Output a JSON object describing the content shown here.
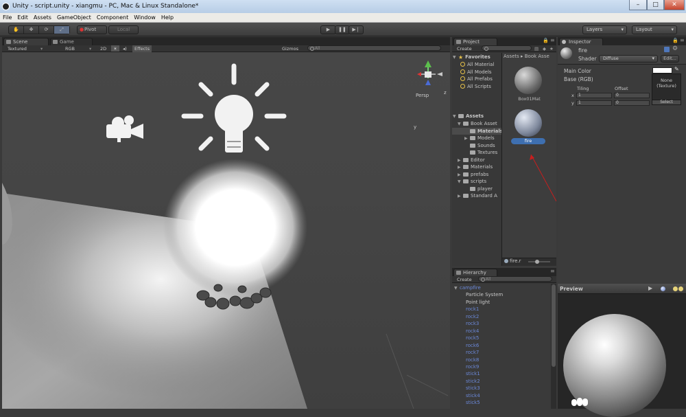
{
  "window": {
    "title": "Unity - script.unity - xiangmu - PC, Mac & Linux Standalone*"
  },
  "menu": [
    "File",
    "Edit",
    "Assets",
    "GameObject",
    "Component",
    "Window",
    "Help"
  ],
  "toolbar": {
    "pivot": "Pivot",
    "local": "Local",
    "layers": "Layers",
    "layout": "Layout"
  },
  "scene": {
    "tab_scene": "Scene",
    "tab_game": "Game",
    "shading": "Textured",
    "render_mode": "RGB",
    "mode_2d": "2D",
    "effects": "Effects",
    "gizmos": "Gizmos",
    "search_placeholder": "All",
    "persp": "Persp"
  },
  "project": {
    "tab": "Project",
    "create": "Create",
    "search_placeholder": "",
    "favorites": {
      "label": "Favorites",
      "items": [
        "All Material",
        "All Models",
        "All Prefabs",
        "All Scripts"
      ]
    },
    "assets": {
      "label": "Assets",
      "items": [
        {
          "label": "Book Asset",
          "level": 1
        },
        {
          "label": "Materials",
          "level": 2
        },
        {
          "label": "Models",
          "level": 2
        },
        {
          "label": "Sounds",
          "level": 2
        },
        {
          "label": "Textures",
          "level": 2
        },
        {
          "label": "Editor",
          "level": 1
        },
        {
          "label": "Materials",
          "level": 1
        },
        {
          "label": "prefabs",
          "level": 1
        },
        {
          "label": "scripts",
          "level": 1
        },
        {
          "label": "player",
          "level": 2
        },
        {
          "label": "Standard A",
          "level": 1
        }
      ]
    },
    "breadcrumb": "Assets ▸ Book Asse",
    "grid_items": [
      "Box01Mat",
      "fire"
    ],
    "footer": "fire.r"
  },
  "hierarchy": {
    "tab": "Hierarchy",
    "create": "Create",
    "search_placeholder": "All",
    "items": [
      {
        "label": "campfire",
        "level": 0,
        "color": "blue"
      },
      {
        "label": "Particle System",
        "level": 1,
        "color": "white"
      },
      {
        "label": "Point light",
        "level": 1,
        "color": "white"
      },
      {
        "label": "rock1",
        "level": 1,
        "color": "blue"
      },
      {
        "label": "rock2",
        "level": 1,
        "color": "blue"
      },
      {
        "label": "rock3",
        "level": 1,
        "color": "blue"
      },
      {
        "label": "rock4",
        "level": 1,
        "color": "blue"
      },
      {
        "label": "rock5",
        "level": 1,
        "color": "blue"
      },
      {
        "label": "rock6",
        "level": 1,
        "color": "blue"
      },
      {
        "label": "rock7",
        "level": 1,
        "color": "blue"
      },
      {
        "label": "rock8",
        "level": 1,
        "color": "blue"
      },
      {
        "label": "rock9",
        "level": 1,
        "color": "blue"
      },
      {
        "label": "stick1",
        "level": 1,
        "color": "blue"
      },
      {
        "label": "stick2",
        "level": 1,
        "color": "blue"
      },
      {
        "label": "stick3",
        "level": 1,
        "color": "blue"
      },
      {
        "label": "stick4",
        "level": 1,
        "color": "blue"
      },
      {
        "label": "stick5",
        "level": 1,
        "color": "blue"
      }
    ]
  },
  "inspector": {
    "tab": "Inspector",
    "name": "fire",
    "shader_label": "Shader",
    "shader_value": "Diffuse",
    "edit": "Edit...",
    "main_color": "Main Color",
    "base_rgb": "Base (RGB)",
    "tiling": "Tiling",
    "offset": "Offset",
    "x_label": "x",
    "y_label": "y",
    "tiling_x": "1",
    "tiling_y": "1",
    "offset_x": "0",
    "offset_y": "0",
    "texture_slot": "None\n(Texture)",
    "select": "Select",
    "preview": "Preview"
  },
  "colors": {
    "accent_blue": "#3e6fb0",
    "tree_blue": "#6b88d8",
    "star": "#e8c24a",
    "annotation_arrow": "#c81e1e"
  }
}
